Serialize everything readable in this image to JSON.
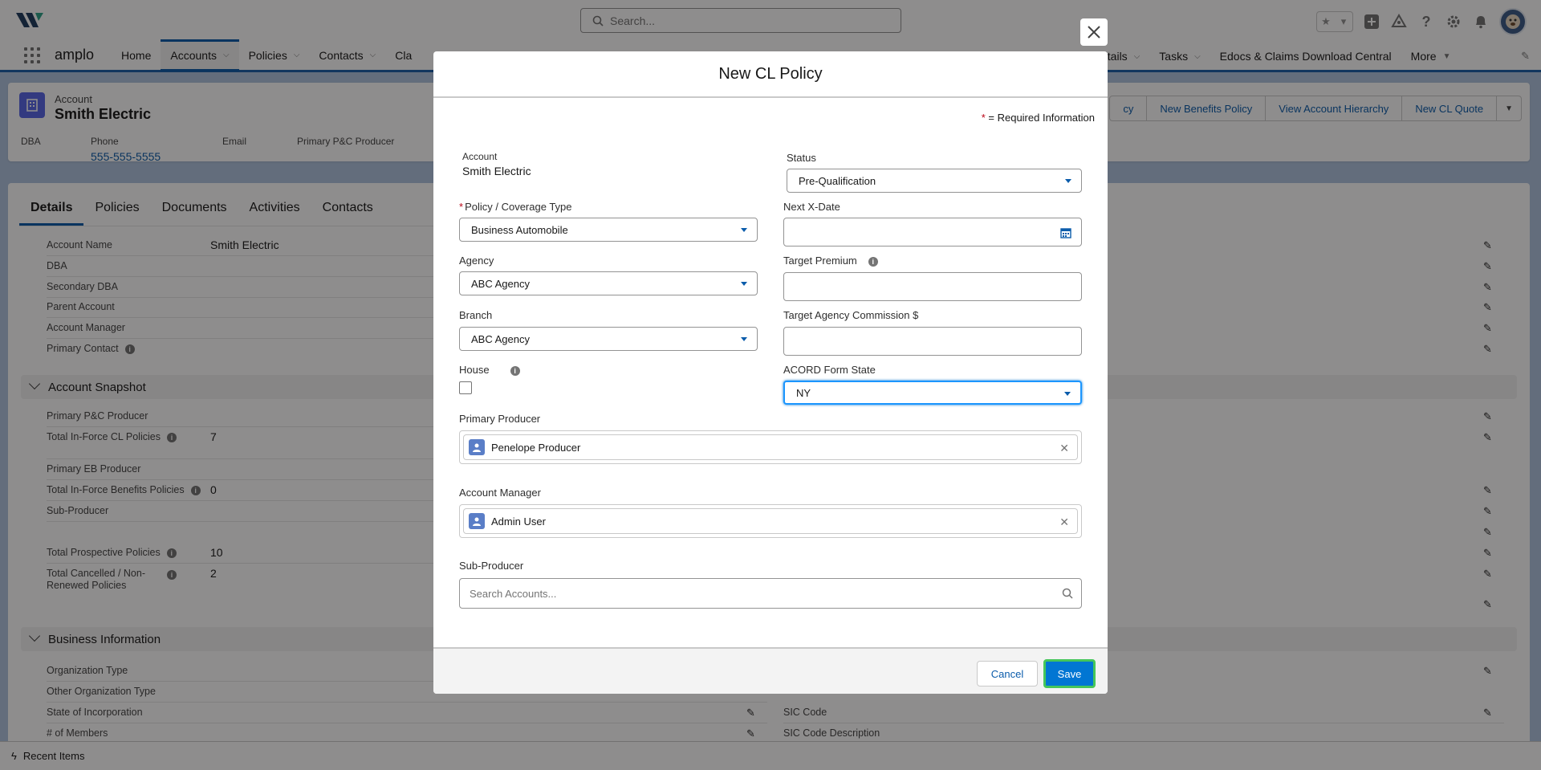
{
  "global_header": {
    "search_placeholder": "Search...",
    "icons": [
      "favorites-star-icon",
      "add-icon",
      "setup-assistant-icon",
      "help-icon",
      "gear-icon",
      "notification-bell-icon",
      "user-avatar"
    ]
  },
  "app_nav": {
    "app_name": "amplo",
    "items": [
      {
        "label": "Home",
        "has_menu": false
      },
      {
        "label": "Accounts",
        "has_menu": true,
        "active": true
      },
      {
        "label": "Policies",
        "has_menu": true
      },
      {
        "label": "Contacts",
        "has_menu": true
      },
      {
        "label": "Cla",
        "has_menu": false
      }
    ],
    "right_items": [
      {
        "label": "etails",
        "has_menu": true
      },
      {
        "label": "Tasks",
        "has_menu": true
      },
      {
        "label": "Edocs & Claims Download Central",
        "has_menu": false
      },
      {
        "label": "More",
        "has_menu": true
      }
    ]
  },
  "record": {
    "object_type": "Account",
    "name": "Smith Electric",
    "highlight_fields": [
      {
        "label": "DBA",
        "value": ""
      },
      {
        "label": "Phone",
        "value": "555-555-5555"
      },
      {
        "label": "Email",
        "value": ""
      },
      {
        "label": "Primary P&C Producer",
        "value": ""
      }
    ],
    "actions": [
      "cy",
      "New Benefits Policy",
      "View Account Hierarchy",
      "New CL Quote"
    ],
    "tabs": [
      "Details",
      "Policies",
      "Documents",
      "Activities",
      "Contacts"
    ],
    "detail_fields": [
      {
        "label": "Account Name",
        "value": "Smith Electric"
      },
      {
        "label": "DBA",
        "value": ""
      },
      {
        "label": "Secondary DBA",
        "value": ""
      },
      {
        "label": "Parent Account",
        "value": ""
      },
      {
        "label": "Account Manager",
        "value": ""
      },
      {
        "label": "Primary Contact",
        "value": ""
      }
    ],
    "snapshot_section": "Account Snapshot",
    "snapshot_fields": [
      {
        "label": "Primary P&C Producer",
        "value": ""
      },
      {
        "label": "Total In-Force CL Policies",
        "value": "7"
      },
      {
        "label": "Primary EB Producer",
        "value": ""
      },
      {
        "label": "Total In-Force Benefits Policies",
        "value": "0"
      },
      {
        "label": "Sub-Producer",
        "value": ""
      },
      {
        "label": "Total Prospective Policies",
        "value": "10"
      },
      {
        "label": "Total Cancelled / Non-Renewed Policies",
        "value": "2"
      }
    ],
    "business_section": "Business Information",
    "business_fields": [
      {
        "label": "Organization Type"
      },
      {
        "label": "Other Organization Type"
      },
      {
        "label": "State of Incorporation"
      },
      {
        "label": "# of Members"
      }
    ],
    "business_right_fields": [
      {
        "label": "SIC Code"
      },
      {
        "label": "SIC Code Description"
      }
    ]
  },
  "utility_bar": {
    "label": "Recent Items"
  },
  "modal": {
    "title": "New CL Policy",
    "required_note": "= Required Information",
    "required_star": "*",
    "account_label": "Account",
    "account_value": "Smith Electric",
    "status_label": "Status",
    "status_value": "Pre-Qualification",
    "coverage_label": "Policy / Coverage Type",
    "coverage_value": "Business Automobile",
    "next_xdate_label": "Next X-Date",
    "next_xdate_value": "",
    "agency_label": "Agency",
    "agency_value": "ABC Agency",
    "target_premium_label": "Target Premium",
    "target_premium_value": "",
    "branch_label": "Branch",
    "branch_value": "ABC Agency",
    "target_commission_label": "Target Agency Commission $",
    "target_commission_value": "",
    "house_label": "House",
    "house_checked": false,
    "acord_label": "ACORD Form State",
    "acord_value": "NY",
    "primary_producer_label": "Primary Producer",
    "primary_producer_value": "Penelope Producer",
    "account_manager_label": "Account Manager",
    "account_manager_value": "Admin User",
    "sub_producer_label": "Sub-Producer",
    "sub_producer_placeholder": "Search Accounts...",
    "cancel_label": "Cancel",
    "save_label": "Save"
  },
  "colors": {
    "brand_blue": "#0176d3",
    "link_blue": "#0b5cab",
    "required_red": "#ba0517",
    "save_focus_green": "#45c65a"
  }
}
